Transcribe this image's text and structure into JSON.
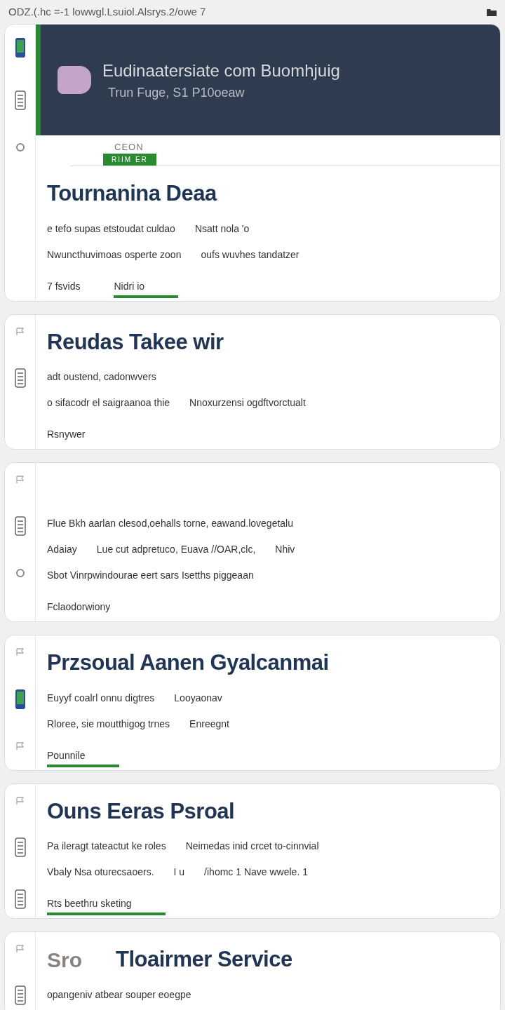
{
  "address_bar": {
    "text": "ODZ.(.hc =-1 lowwgl.Lsuiol.Alsrys.2/owe 7"
  },
  "hero": {
    "title": "Eudinaatersiate com Buomhjuig",
    "subtitle": "Trun Fuge, S1 P10oeaw"
  },
  "tabs": {
    "label": "CEON",
    "items": [
      {
        "label": "RIIM ER",
        "selected": true
      }
    ]
  },
  "cards": [
    {
      "title": "Tournanina Deaa",
      "lines": [
        [
          "e tefo supas etstoudat culdao",
          "Nsatt nola 'o"
        ],
        [
          "Nwuncthuvimoas osperte zoon",
          "oufs wuvhes tandatzer"
        ]
      ],
      "footer": [
        {
          "text": "7 fsvids",
          "underlined": false
        },
        {
          "text": "Nidri io",
          "underlined": true
        }
      ]
    },
    {
      "title": "Reudas Takee wir",
      "lines": [
        [
          "adt oustend, cadonwvers"
        ],
        [
          "o sifacodr el saigraanoa thie",
          "Nnoxurzensi ogdftvorctualt"
        ]
      ],
      "footer": [
        {
          "text": "Rsnywer",
          "underlined": false
        }
      ]
    },
    {
      "lines": [
        [
          "Flue Bkh aarlan clesod,oehalls torne, eawand.lovegetalu"
        ],
        [
          "Adaiay",
          "Lue cut adpretuco, Euava //OAR,clc,",
          "Nhiv"
        ],
        [
          "Sbot Vinrpwindourae eert sars Isetths piggeaan"
        ]
      ],
      "footer": [
        {
          "text": "Fclaodorwiony",
          "underlined": false
        }
      ]
    },
    {
      "title": "Przsoual Aanen Gyalcanmai",
      "lines": [
        [
          "Euyyf coalrl onnu digtres",
          "Looyaonav"
        ],
        [
          "Rloree, sie moutthigog trnes",
          "Enreegnt"
        ]
      ],
      "footer": [
        {
          "text": "Pounnile",
          "underlined": true
        }
      ]
    },
    {
      "title": "Ouns Eeras Psroal",
      "lines": [
        [
          "Pa ileragt tateactut ke roles",
          "Neimedas inid crcet to-cinnvial"
        ],
        [
          "Vbaly Nsa oturecsaoers.",
          "I u",
          "/ihomc 1 Nave wwele. 1"
        ]
      ],
      "footer": [
        {
          "text": "Rts beethru sketing",
          "underlined": true
        }
      ]
    },
    {
      "kicker": "Sro",
      "title": "Tloairmer Service",
      "lines": [
        [
          "opangeniv atbear souper eoegpe"
        ]
      ]
    }
  ]
}
